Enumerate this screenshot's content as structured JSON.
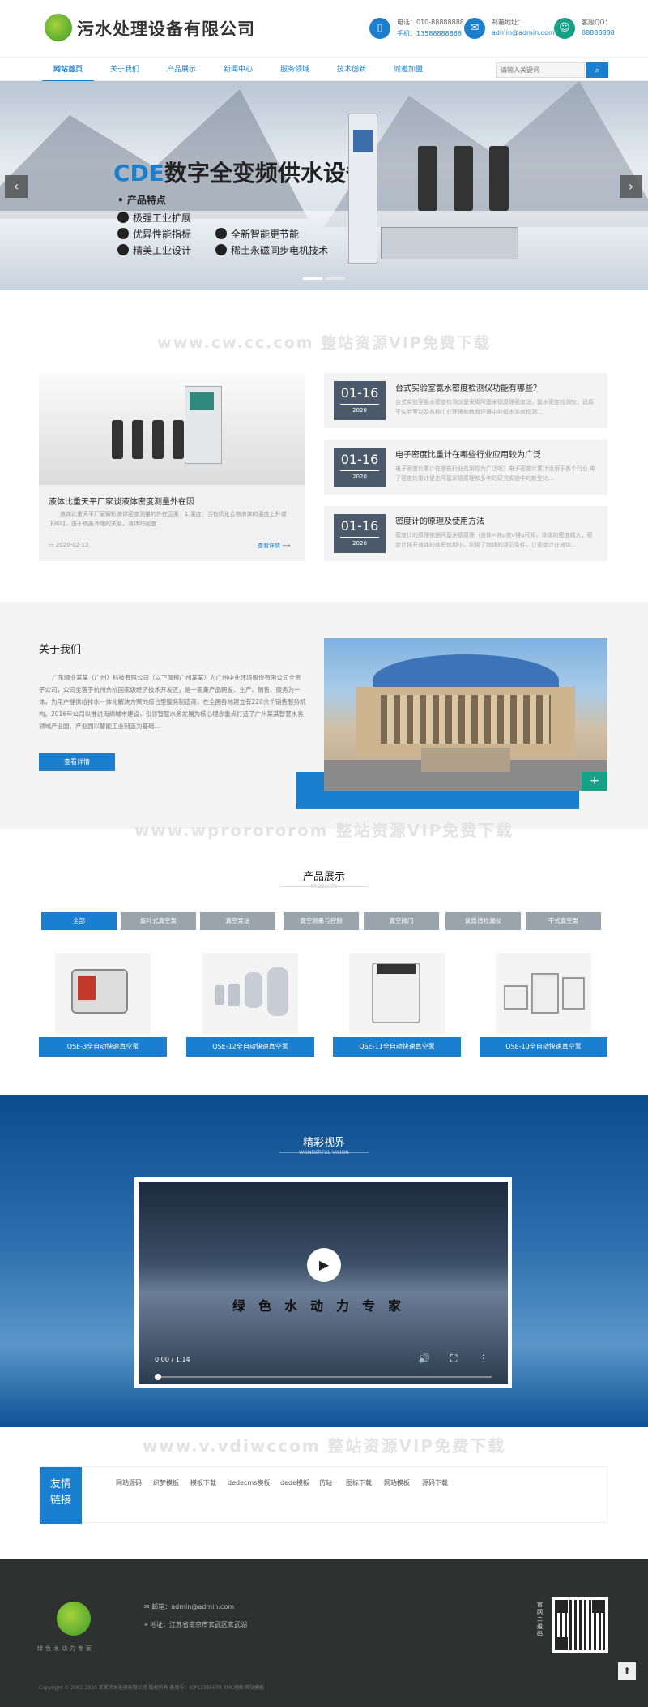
{
  "header": {
    "logo_text": "污水处理设备有限公司",
    "contact_phone_label": "电话：010-88888888",
    "contact_phone_mobile": "手机：13588888888",
    "contact_email_label": "邮箱地址：",
    "contact_email": "admin@admin.com",
    "contact_qq_label": "客服QQ：",
    "contact_qq": "88888888"
  },
  "nav": {
    "items": [
      "网站首页",
      "关于我们",
      "产品展示",
      "新闻中心",
      "服务领域",
      "技术创新",
      "诚邀加盟"
    ],
    "search_placeholder": "请输入关键词",
    "search_icon": "search-icon"
  },
  "banner": {
    "title_prefix": "CDE",
    "title_rest": "数字全变频供水设备",
    "subtitle": "产品特点",
    "features": [
      "极强工业扩展",
      "优异性能指标",
      "全新智能更节能",
      "精美工业设计",
      "稀土永磁同步电机技术"
    ]
  },
  "news": {
    "watermark": "www.cw.cc.com  整站资源VIP免费下载",
    "featured_title": "液体比重天平厂家谈液体密度测量外在因",
    "featured_summary": "液体比重天平厂家解析液体密度测量的外在因素：1.温度：当有机化合物液体的温度上升或下降时，由于热胀冷缩的关系，液体的密度...",
    "featured_date": "2020-02-12",
    "more_label": "查看详情",
    "items": [
      {
        "day": "01-16",
        "year": "2020",
        "title": "台式实验室氨水密度检测仪功能有哪些？",
        "summary": "台式实验室氨水密度检测仪是采用阿基米德原理密度法。氨水密度检测仪，适用于实验室以及各种工业环境和教育环境中的氨水浓度检测..."
      },
      {
        "day": "01-16",
        "year": "2020",
        "title": "电子密度比重计在哪些行业应用较为广泛",
        "summary": "电子密度比重计在哪些行业应用较为广泛呢？电子密度比重计适用于各个行业 电子密度比重计是由阿基米德原理和多年的研究实验中的新型比..."
      },
      {
        "day": "01-16",
        "year": "2020",
        "title": "密度计的原理及使用方法",
        "summary": "密度计的原理依据阿基米德原理（液体=液p液V排g可知，液体的密度越大，密度计排开液体的体积就越小，利用了物体的浮沉条件，让密度计在液体..."
      }
    ]
  },
  "about": {
    "title": "关于我们",
    "text": "广东顺业某某（广州）科技有限公司（以下简称广州某某）为广州中业环境股份有限公司全资子公司，公司坐落于杭州余杭国家级经济技术开发区，是一家集产品研发、生产、销售、服务为一体，为用户提供给排水一体化解决方案的综合型服务制造商，在全国各地建立有220余个销售服务机构。2016年公司以推进海绵城市建设，引领智慧水务发展为核心理念重点打造了广州某某智慧水务领域产业园，产业园以智能工业制造为基础...",
    "button": "查看详情"
  },
  "products": {
    "watermark": "www.wprorororom  整站资源VIP免费下载",
    "title": "产品展示",
    "subtitle": "PRODUCTS",
    "tabs": [
      "全部",
      "旋叶式真空泵",
      "真空泵油",
      "真空测量与控制",
      "真空阀门",
      "氦质谱检漏仪",
      "干式真空泵"
    ],
    "items": [
      "QSE-3全自动快速真空泵",
      "QSE-12全自动快速真空泵",
      "QSE-11全自动快速真空泵",
      "QSE-10全自动快速真空泵"
    ]
  },
  "video": {
    "title": "精彩视界",
    "subtitle": "WONDERFUL VISION",
    "caption": "绿色水动力专家",
    "time": "0:00 / 1:14"
  },
  "links": {
    "watermark": "www.v.vdiwccom  整站资源VIP免费下载",
    "label_line1": "友情",
    "label_line2": "链接",
    "items": [
      "网站源码",
      "织梦模板",
      "模板下载",
      "dedecms模板",
      "dede模板",
      "仿站",
      "图标下载",
      "网站模板",
      "源码下载"
    ]
  },
  "footer": {
    "slogan": "绿色水动力专家",
    "email": "邮箱：admin@admin.com",
    "address": "地址：江苏省南京市玄武区玄武湖",
    "qr_label": "官网二维码",
    "copyright": "Copyright © 2002-2020 某某污水处理有限公司 版权所有 备案号：ICP12345678 XML地图 网站模板"
  }
}
